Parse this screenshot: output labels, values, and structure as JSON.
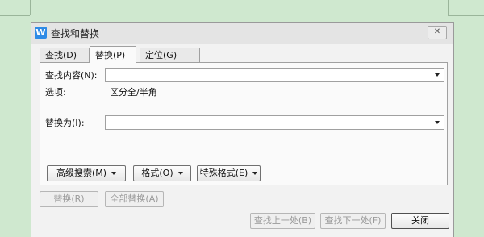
{
  "dialog": {
    "title": "查找和替换",
    "app_icon": "W",
    "close_glyph": "✕"
  },
  "tabs": [
    {
      "label": "查找(D)",
      "active": false
    },
    {
      "label": "替换(P)",
      "active": true
    },
    {
      "label": "定位(G)",
      "active": false
    }
  ],
  "find": {
    "label": "查找内容(N):",
    "value": ""
  },
  "options": {
    "label": "选项:",
    "value": "区分全/半角"
  },
  "replace": {
    "label": "替换为(I):",
    "value": ""
  },
  "buttons": {
    "advanced_search": "高级搜索(M)",
    "format": "格式(O)",
    "special_format": "特殊格式(E)",
    "replace": "替换(R)",
    "replace_all": "全部替换(A)",
    "find_previous": "查找上一处(B)",
    "find_next": "查找下一处(F)",
    "close": "关闭"
  },
  "icons": {
    "app": "wps-writer-icon",
    "close": "close-icon",
    "dropdown": "chevron-down-icon"
  },
  "colors": {
    "background": "#cfe8cf",
    "app_icon": "#2f8be6"
  }
}
